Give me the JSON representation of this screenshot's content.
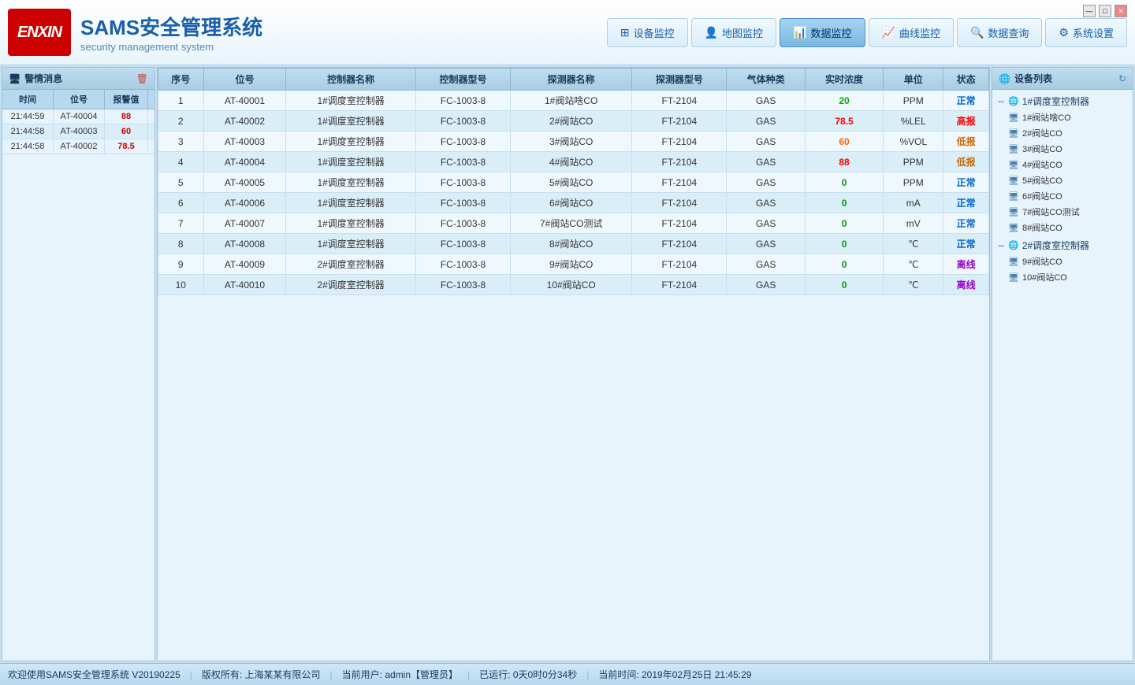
{
  "app": {
    "title_main": "SAMS安全管理系统",
    "title_sub": "security management system",
    "logo_text": "ENXIN"
  },
  "nav": {
    "items": [
      {
        "label": "设备监控",
        "icon": "⊞",
        "active": false
      },
      {
        "label": "地图监控",
        "icon": "👤",
        "active": false
      },
      {
        "label": "数据监控",
        "icon": "📊",
        "active": true
      },
      {
        "label": "曲线监控",
        "icon": "📈",
        "active": false
      },
      {
        "label": "数据查询",
        "icon": "🔍",
        "active": false
      },
      {
        "label": "系统设置",
        "icon": "⚙",
        "active": false
      }
    ]
  },
  "alarm_panel": {
    "title": "警情消息",
    "columns": [
      "时间",
      "位号",
      "报警值"
    ],
    "rows": [
      {
        "time": "21:44:59",
        "tag": "AT-40004",
        "value": "88"
      },
      {
        "time": "21:44:58",
        "tag": "AT-40003",
        "value": "60"
      },
      {
        "time": "21:44:58",
        "tag": "AT-40002",
        "value": "78.5"
      }
    ]
  },
  "data_table": {
    "columns": [
      "序号",
      "位号",
      "控制器名称",
      "控制器型号",
      "探测器名称",
      "探测器型号",
      "气体种类",
      "实时浓度",
      "单位",
      "状态"
    ],
    "rows": [
      {
        "seq": "1",
        "tag": "AT-40001",
        "ctrl_name": "1#调度室控制器",
        "ctrl_model": "FC-1003-8",
        "det_name": "1#阀站啥CO",
        "det_model": "FT-2104",
        "gas": "GAS",
        "conc": "20",
        "unit": "PPM",
        "status": "正常",
        "status_class": "status-normal",
        "conc_class": "conc-highlight-green"
      },
      {
        "seq": "2",
        "tag": "AT-40002",
        "ctrl_name": "1#调度室控制器",
        "ctrl_model": "FC-1003-8",
        "det_name": "2#阀站CO",
        "det_model": "FT-2104",
        "gas": "GAS",
        "conc": "78.5",
        "unit": "%LEL",
        "status": "高报",
        "status_class": "status-high",
        "conc_class": "conc-highlight-red"
      },
      {
        "seq": "3",
        "tag": "AT-40003",
        "ctrl_name": "1#调度室控制器",
        "ctrl_model": "FC-1003-8",
        "det_name": "3#阀站CO",
        "det_model": "FT-2104",
        "gas": "GAS",
        "conc": "60",
        "unit": "%VOL",
        "status": "低报",
        "status_class": "status-low",
        "conc_class": "conc-highlight-orange"
      },
      {
        "seq": "4",
        "tag": "AT-40004",
        "ctrl_name": "1#调度室控制器",
        "ctrl_model": "FC-1003-8",
        "det_name": "4#阀站CO",
        "det_model": "FT-2104",
        "gas": "GAS",
        "conc": "88",
        "unit": "PPM",
        "status": "低报",
        "status_class": "status-low",
        "conc_class": "conc-highlight-red"
      },
      {
        "seq": "5",
        "tag": "AT-40005",
        "ctrl_name": "1#调度室控制器",
        "ctrl_model": "FC-1003-8",
        "det_name": "5#阀站CO",
        "det_model": "FT-2104",
        "gas": "GAS",
        "conc": "0",
        "unit": "PPM",
        "status": "正常",
        "status_class": "status-normal",
        "conc_class": "conc-zero"
      },
      {
        "seq": "6",
        "tag": "AT-40006",
        "ctrl_name": "1#调度室控制器",
        "ctrl_model": "FC-1003-8",
        "det_name": "6#阀站CO",
        "det_model": "FT-2104",
        "gas": "GAS",
        "conc": "0",
        "unit": "mA",
        "status": "正常",
        "status_class": "status-normal",
        "conc_class": "conc-zero"
      },
      {
        "seq": "7",
        "tag": "AT-40007",
        "ctrl_name": "1#调度室控制器",
        "ctrl_model": "FC-1003-8",
        "det_name": "7#阀站CO测试",
        "det_model": "FT-2104",
        "gas": "GAS",
        "conc": "0",
        "unit": "mV",
        "status": "正常",
        "status_class": "status-normal",
        "conc_class": "conc-zero"
      },
      {
        "seq": "8",
        "tag": "AT-40008",
        "ctrl_name": "1#调度室控制器",
        "ctrl_model": "FC-1003-8",
        "det_name": "8#阀站CO",
        "det_model": "FT-2104",
        "gas": "GAS",
        "conc": "0",
        "unit": "℃",
        "status": "正常",
        "status_class": "status-normal",
        "conc_class": "conc-zero"
      },
      {
        "seq": "9",
        "tag": "AT-40009",
        "ctrl_name": "2#调度室控制器",
        "ctrl_model": "FC-1003-8",
        "det_name": "9#阀站CO",
        "det_model": "FT-2104",
        "gas": "GAS",
        "conc": "0",
        "unit": "℃",
        "status": "离线",
        "status_class": "status-offline",
        "conc_class": "conc-zero"
      },
      {
        "seq": "10",
        "tag": "AT-40010",
        "ctrl_name": "2#调度室控制器",
        "ctrl_model": "FC-1003-8",
        "det_name": "10#阀站CO",
        "det_model": "FT-2104",
        "gas": "GAS",
        "conc": "0",
        "unit": "℃",
        "status": "离线",
        "status_class": "status-offline",
        "conc_class": "conc-zero"
      }
    ]
  },
  "device_panel": {
    "title": "设备列表",
    "groups": [
      {
        "name": "1#调度室控制器",
        "children": [
          "1#阀站啥CO",
          "2#阀站CO",
          "3#阀站CO",
          "4#阀站CO",
          "5#阀站CO",
          "6#阀站CO",
          "7#阀站CO测试",
          "8#阀站CO"
        ]
      },
      {
        "name": "2#调度室控制器",
        "children": [
          "9#阀站CO",
          "10#阀站CO"
        ]
      }
    ]
  },
  "status_bar": {
    "welcome": "欢迎使用SAMS安全管理系统 V20190225",
    "copyright": "版权所有: 上海某某有限公司",
    "user": "当前用户: admin【管理员】",
    "runtime": "已运行: 0天0时0分34秒",
    "datetime": "当前时间: 2019年02月25日 21:45:29"
  },
  "window_controls": {
    "minimize": "—",
    "maximize": "□",
    "close": "✕"
  }
}
